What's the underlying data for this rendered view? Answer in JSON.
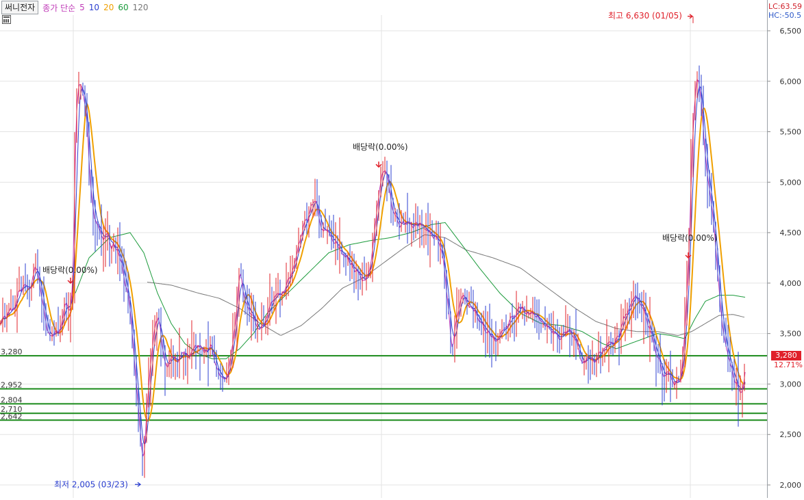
{
  "header": {
    "stock_name": "써니전자",
    "legend_label": "종가 단순",
    "ma_periods": [
      "5",
      "10",
      "20",
      "60",
      "120"
    ]
  },
  "axis_info": {
    "lc_text": "LC:63.59",
    "hc_text": "HC:-50.5"
  },
  "colors": {
    "candle_up": "#e0202a",
    "candle_down": "#2b3fd0",
    "ma5": "#c03cb8",
    "ma10": "#2b3fd0",
    "ma20": "#f0a000",
    "ma60": "#1a9a3a",
    "ma120": "#777777",
    "support_line": "#1a8a1a"
  },
  "current_price": {
    "label": "3,280",
    "change": "12.71%"
  },
  "annotations": {
    "max_label": "최고 6,630 (01/05)",
    "min_label": "최저 2,005 (03/23)",
    "dividend_label": "배당락(0.00%)"
  },
  "support_levels": [
    {
      "value": 3280,
      "label": "3,280"
    },
    {
      "value": 2952,
      "label": "2,952"
    },
    {
      "value": 2804,
      "label": "2,804"
    },
    {
      "value": 2710,
      "label": "2,710"
    },
    {
      "value": 2642,
      "label": "2,642"
    }
  ],
  "chart_data": {
    "type": "line",
    "title": "",
    "xlabel": "",
    "ylabel": "",
    "ylim": [
      1950,
      6700
    ],
    "yticks": [
      2000,
      2500,
      3000,
      3500,
      4000,
      4500,
      5000,
      5500,
      6000,
      6500
    ],
    "ytick_labels": [
      "2,000",
      "2,500",
      "3,000",
      "3,500",
      "4,000",
      "4,500",
      "5,000",
      "5,500",
      "6,000",
      "6,500"
    ],
    "grid": true,
    "price_keypoints": [
      [
        0,
        3650
      ],
      [
        10,
        3700
      ],
      [
        20,
        3800
      ],
      [
        28,
        3950
      ],
      [
        35,
        4000
      ],
      [
        42,
        3900
      ],
      [
        50,
        4200
      ],
      [
        55,
        4050
      ],
      [
        60,
        3850
      ],
      [
        65,
        3600
      ],
      [
        70,
        3500
      ],
      [
        75,
        3450
      ],
      [
        80,
        3550
      ],
      [
        85,
        3500
      ],
      [
        90,
        3700
      ],
      [
        95,
        3800
      ],
      [
        100,
        3700
      ],
      [
        105,
        4000
      ],
      [
        108,
        5400
      ],
      [
        112,
        5900
      ],
      [
        117,
        6000
      ],
      [
        121,
        5800
      ],
      [
        125,
        5600
      ],
      [
        130,
        4900
      ],
      [
        135,
        4700
      ],
      [
        140,
        4600
      ],
      [
        145,
        4500
      ],
      [
        150,
        4450
      ],
      [
        155,
        4500
      ],
      [
        160,
        4350
      ],
      [
        165,
        4400
      ],
      [
        170,
        4300
      ],
      [
        175,
        4200
      ],
      [
        180,
        4000
      ],
      [
        185,
        3900
      ],
      [
        190,
        3600
      ],
      [
        195,
        3200
      ],
      [
        200,
        2800
      ],
      [
        204,
        2400
      ],
      [
        208,
        2200
      ],
      [
        212,
        2700
      ],
      [
        218,
        3200
      ],
      [
        224,
        3600
      ],
      [
        230,
        3700
      ],
      [
        236,
        3300
      ],
      [
        242,
        3150
      ],
      [
        250,
        3300
      ],
      [
        258,
        3200
      ],
      [
        266,
        3350
      ],
      [
        274,
        3250
      ],
      [
        282,
        3350
      ],
      [
        290,
        3400
      ],
      [
        298,
        3300
      ],
      [
        306,
        3350
      ],
      [
        314,
        3150
      ],
      [
        322,
        3100
      ],
      [
        330,
        3050
      ],
      [
        336,
        3300
      ],
      [
        342,
        3600
      ],
      [
        348,
        4100
      ],
      [
        354,
        3900
      ],
      [
        360,
        3750
      ],
      [
        366,
        3700
      ],
      [
        372,
        3600
      ],
      [
        380,
        3550
      ],
      [
        388,
        3650
      ],
      [
        396,
        3850
      ],
      [
        404,
        3900
      ],
      [
        412,
        3950
      ],
      [
        420,
        4000
      ],
      [
        430,
        4200
      ],
      [
        440,
        4550
      ],
      [
        450,
        4700
      ],
      [
        458,
        4850
      ],
      [
        466,
        4600
      ],
      [
        474,
        4500
      ],
      [
        482,
        4450
      ],
      [
        490,
        4400
      ],
      [
        498,
        4300
      ],
      [
        506,
        4250
      ],
      [
        514,
        4150
      ],
      [
        522,
        4100
      ],
      [
        530,
        4000
      ],
      [
        538,
        4100
      ],
      [
        545,
        4500
      ],
      [
        552,
        4900
      ],
      [
        558,
        5100
      ],
      [
        564,
        5050
      ],
      [
        570,
        4800
      ],
      [
        576,
        4650
      ],
      [
        584,
        4550
      ],
      [
        592,
        4600
      ],
      [
        600,
        4550
      ],
      [
        608,
        4600
      ],
      [
        616,
        4550
      ],
      [
        624,
        4500
      ],
      [
        632,
        4450
      ],
      [
        640,
        4400
      ],
      [
        648,
        4100
      ],
      [
        654,
        3700
      ],
      [
        658,
        3300
      ],
      [
        664,
        3600
      ],
      [
        672,
        3900
      ],
      [
        680,
        3800
      ],
      [
        688,
        3750
      ],
      [
        696,
        3650
      ],
      [
        704,
        3600
      ],
      [
        712,
        3500
      ],
      [
        720,
        3450
      ],
      [
        728,
        3500
      ],
      [
        736,
        3550
      ],
      [
        744,
        3650
      ],
      [
        752,
        3700
      ],
      [
        760,
        3750
      ],
      [
        768,
        3650
      ],
      [
        776,
        3700
      ],
      [
        784,
        3650
      ],
      [
        792,
        3600
      ],
      [
        800,
        3550
      ],
      [
        808,
        3500
      ],
      [
        816,
        3450
      ],
      [
        824,
        3550
      ],
      [
        832,
        3500
      ],
      [
        840,
        3400
      ],
      [
        848,
        3200
      ],
      [
        856,
        3250
      ],
      [
        864,
        3200
      ],
      [
        872,
        3300
      ],
      [
        880,
        3350
      ],
      [
        888,
        3450
      ],
      [
        896,
        3400
      ],
      [
        904,
        3550
      ],
      [
        912,
        3700
      ],
      [
        920,
        3800
      ],
      [
        928,
        3900
      ],
      [
        936,
        3750
      ],
      [
        944,
        3600
      ],
      [
        952,
        3400
      ],
      [
        960,
        3250
      ],
      [
        968,
        3050
      ],
      [
        976,
        3100
      ],
      [
        984,
        3000
      ],
      [
        992,
        3050
      ],
      [
        998,
        3500
      ],
      [
        1004,
        4300
      ],
      [
        1010,
        5600
      ],
      [
        1016,
        6100
      ],
      [
        1022,
        5800
      ],
      [
        1028,
        5300
      ],
      [
        1034,
        4900
      ],
      [
        1040,
        4600
      ],
      [
        1046,
        4100
      ],
      [
        1052,
        3600
      ],
      [
        1058,
        3400
      ],
      [
        1064,
        3200
      ],
      [
        1070,
        3050
      ],
      [
        1076,
        2950
      ],
      [
        1082,
        2900
      ],
      [
        1088,
        3200
      ]
    ],
    "ma60_keypoints": [
      [
        110,
        3900
      ],
      [
        130,
        4250
      ],
      [
        160,
        4450
      ],
      [
        190,
        4500
      ],
      [
        210,
        4300
      ],
      [
        230,
        3900
      ],
      [
        250,
        3600
      ],
      [
        270,
        3400
      ],
      [
        290,
        3300
      ],
      [
        310,
        3250
      ],
      [
        330,
        3250
      ],
      [
        350,
        3350
      ],
      [
        370,
        3500
      ],
      [
        390,
        3700
      ],
      [
        420,
        3900
      ],
      [
        450,
        4100
      ],
      [
        480,
        4300
      ],
      [
        510,
        4380
      ],
      [
        540,
        4420
      ],
      [
        570,
        4450
      ],
      [
        600,
        4500
      ],
      [
        630,
        4580
      ],
      [
        650,
        4600
      ],
      [
        670,
        4420
      ],
      [
        700,
        4150
      ],
      [
        730,
        3900
      ],
      [
        760,
        3700
      ],
      [
        790,
        3600
      ],
      [
        820,
        3580
      ],
      [
        850,
        3520
      ],
      [
        880,
        3400
      ],
      [
        900,
        3350
      ],
      [
        920,
        3400
      ],
      [
        940,
        3450
      ],
      [
        960,
        3500
      ],
      [
        980,
        3480
      ],
      [
        1000,
        3450
      ],
      [
        1015,
        3650
      ],
      [
        1030,
        3820
      ],
      [
        1050,
        3880
      ],
      [
        1070,
        3880
      ],
      [
        1088,
        3860
      ]
    ],
    "ma120_keypoints": [
      [
        215,
        4010
      ],
      [
        250,
        3980
      ],
      [
        290,
        3900
      ],
      [
        320,
        3850
      ],
      [
        350,
        3750
      ],
      [
        380,
        3600
      ],
      [
        410,
        3480
      ],
      [
        440,
        3580
      ],
      [
        470,
        3750
      ],
      [
        500,
        3950
      ],
      [
        530,
        4050
      ],
      [
        560,
        4200
      ],
      [
        590,
        4350
      ],
      [
        620,
        4480
      ],
      [
        650,
        4450
      ],
      [
        680,
        4330
      ],
      [
        720,
        4250
      ],
      [
        760,
        4150
      ],
      [
        800,
        3950
      ],
      [
        840,
        3750
      ],
      [
        870,
        3620
      ],
      [
        900,
        3550
      ],
      [
        930,
        3520
      ],
      [
        960,
        3520
      ],
      [
        990,
        3480
      ],
      [
        1010,
        3520
      ],
      [
        1030,
        3600
      ],
      [
        1050,
        3680
      ],
      [
        1070,
        3690
      ],
      [
        1088,
        3660
      ]
    ],
    "series": [
      {
        "name": "5",
        "color_key": "ma5"
      },
      {
        "name": "10",
        "color_key": "ma10"
      },
      {
        "name": "20",
        "color_key": "ma20"
      },
      {
        "name": "60",
        "color_key": "ma60"
      },
      {
        "name": "120",
        "color_key": "ma120"
      }
    ],
    "markers": {
      "max": {
        "x": 1012,
        "value": 6630
      },
      "min": {
        "x": 205,
        "value": 2005
      },
      "dividend_arrows": [
        {
          "x": 103,
          "value": 4000
        },
        {
          "x": 553,
          "value": 5150
        },
        {
          "x": 1005,
          "value": 4250
        }
      ],
      "dividend_label_positions": [
        {
          "x": 62,
          "value": 4100
        },
        {
          "x": 515,
          "value": 5320
        },
        {
          "x": 967,
          "value": 4420
        }
      ]
    }
  }
}
